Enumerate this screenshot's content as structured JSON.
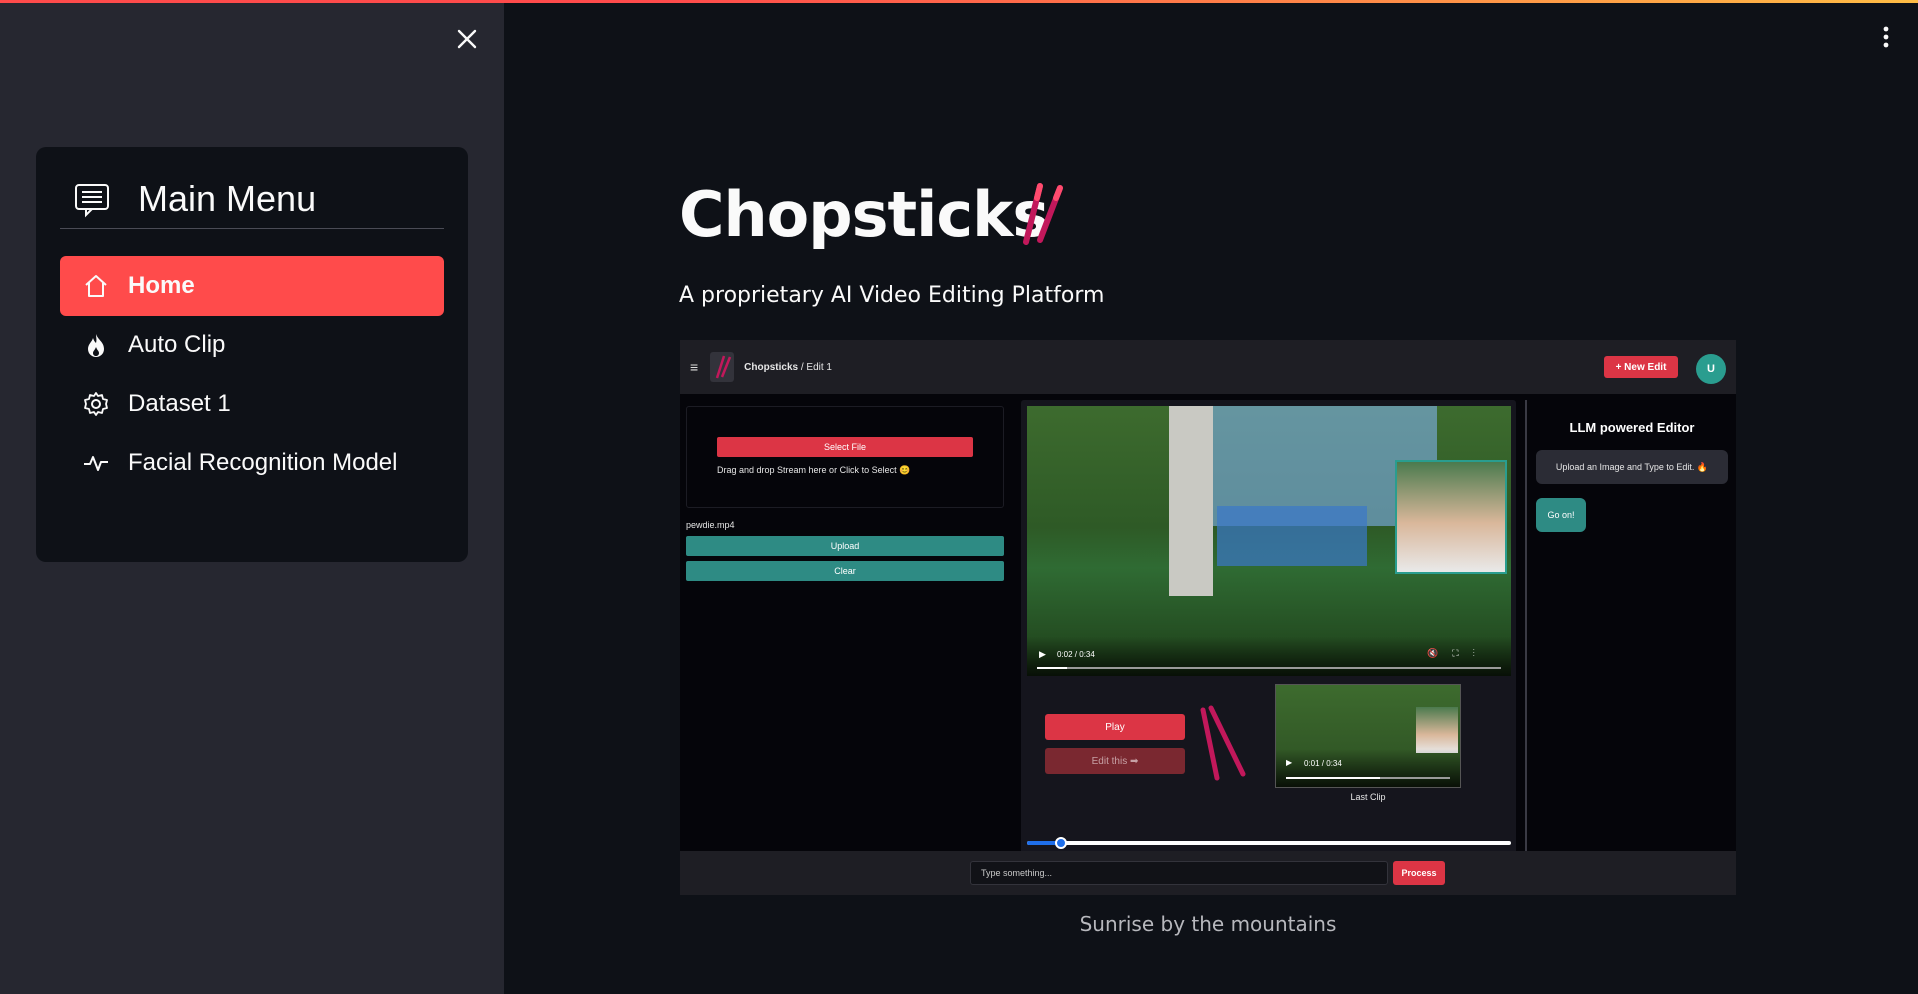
{
  "sidebar": {
    "menu_title": "Main Menu",
    "items": [
      {
        "label": "Home",
        "icon": "house-icon",
        "active": true
      },
      {
        "label": "Auto Clip",
        "icon": "fire-icon",
        "active": false
      },
      {
        "label": "Dataset 1",
        "icon": "gear-icon",
        "active": false
      },
      {
        "label": "Facial Recognition Model",
        "icon": "activity-icon",
        "active": false
      }
    ]
  },
  "main": {
    "title": "Chopsticks",
    "subtitle": "A proprietary AI Video Editing Platform",
    "image_caption": "Sunrise by the mountains"
  },
  "shot": {
    "menu_glyph": "≡",
    "breadcrumb_app": "Chopsticks",
    "breadcrumb_sep": " / ",
    "breadcrumb_page": "Edit 1",
    "new_edit_label": "+ New Edit",
    "avatar_letter": "U",
    "select_file_label": "Select File",
    "drop_hint": "Drag and drop Stream here or Click to Select 😊",
    "file_name": "pewdie.mp4",
    "upload_label": "Upload",
    "clear_label": "Clear",
    "video_time": "0:02 / 0:34",
    "play_label": "Play",
    "edit_this_label": "Edit this ➡",
    "last_clip_time": "0:01 / 0:34",
    "last_clip_label": "Last Clip",
    "llm_title": "LLM powered Editor",
    "llm_message": "Upload an Image and Type to Edit. 🔥",
    "go_on_label": "Go on!",
    "type_placeholder": "Type something...",
    "process_label": "Process"
  },
  "colors": {
    "accent": "#ff4b4b",
    "sidebar_bg": "#262730",
    "app_bg": "#0e1117",
    "teal": "#2e8b84"
  }
}
